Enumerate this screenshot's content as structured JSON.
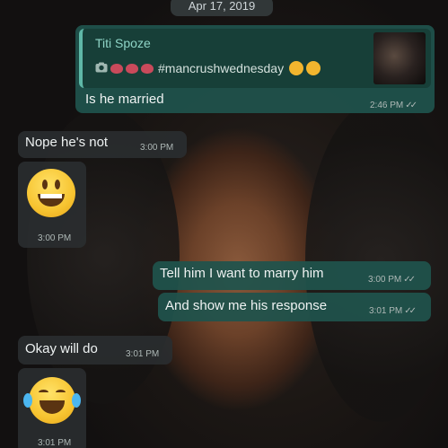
{
  "date_chip": "Apr 17, 2019",
  "reply_quote": {
    "author": "Titi Spoze",
    "text": "#mancrushwednesday"
  },
  "messages": [
    {
      "direction": "out",
      "text": "Is he married",
      "time": "2:46 PM",
      "read": true
    },
    {
      "direction": "in",
      "text": "Nope he's not",
      "time": "3:00 PM"
    },
    {
      "direction": "in",
      "emoji": "😃",
      "time": "3:00 PM"
    },
    {
      "direction": "out",
      "text": "Tell him I want to marry him",
      "time": "3:00 PM",
      "read": true
    },
    {
      "direction": "out",
      "text": "And show me his response",
      "time": "3:01 PM",
      "read": true
    },
    {
      "direction": "in",
      "text": "Okay will do",
      "time": "3:01 PM"
    },
    {
      "direction": "in",
      "emoji": "😂",
      "time": "3:01 PM"
    }
  ],
  "colors": {
    "outgoing_bubble": "#1f534c",
    "incoming_bubble": "#2a2e30",
    "quote_accent": "#5fb8a7"
  },
  "icons": [
    "camera-icon",
    "double-check-icon"
  ]
}
